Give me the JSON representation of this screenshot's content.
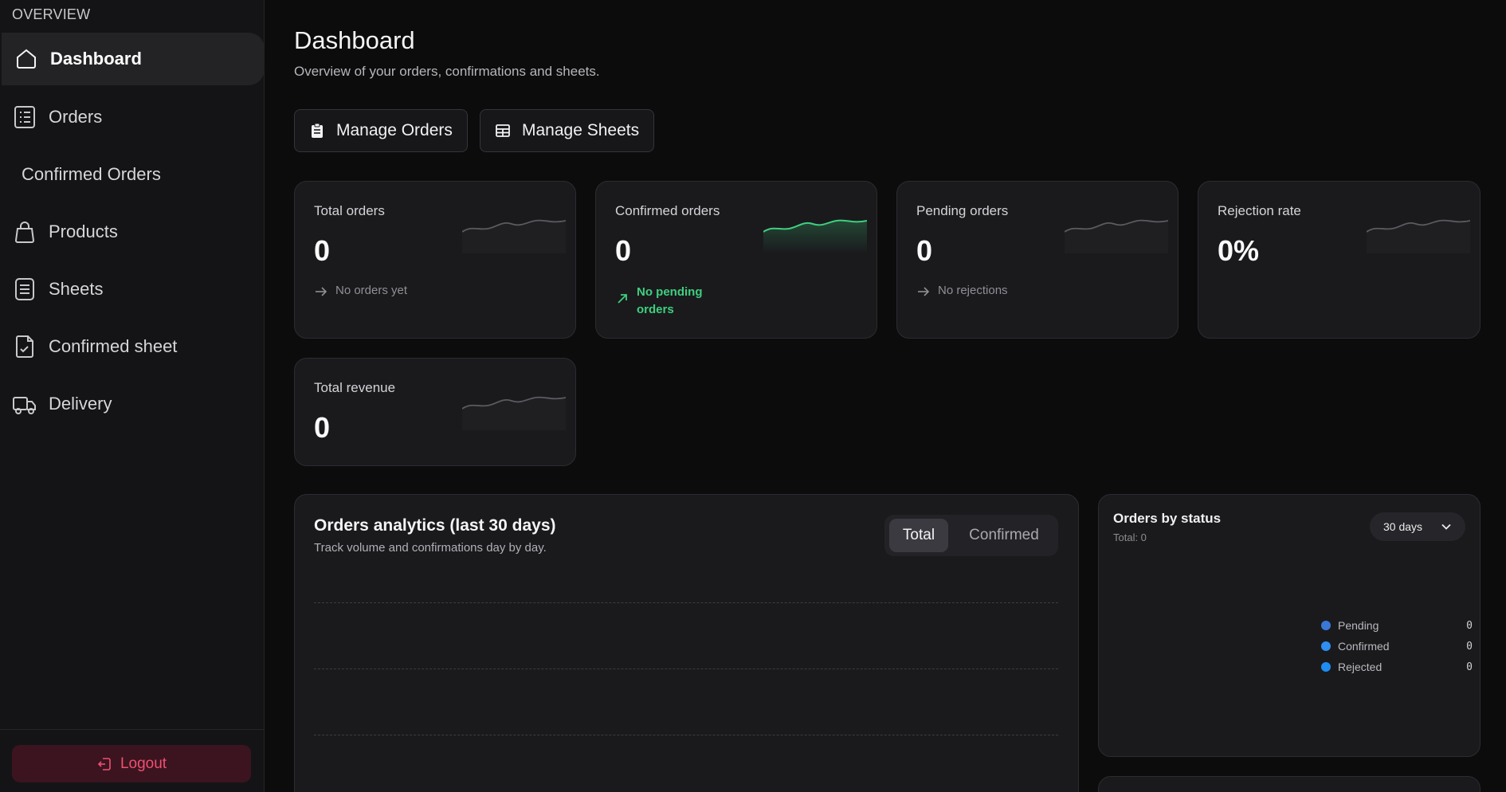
{
  "sidebar": {
    "section": "OVERVIEW",
    "items": [
      {
        "label": "Dashboard",
        "icon": "home-icon",
        "active": true
      },
      {
        "label": "Orders",
        "icon": "list-icon"
      },
      {
        "label": "Confirmed Orders",
        "icon": ""
      },
      {
        "label": "Products",
        "icon": "bag-icon"
      },
      {
        "label": "Sheets",
        "icon": "sheet-icon"
      },
      {
        "label": "Confirmed sheet",
        "icon": "file-check-icon"
      },
      {
        "label": "Delivery",
        "icon": "truck-icon"
      }
    ],
    "logout": "Logout"
  },
  "header": {
    "title": "Dashboard",
    "subtitle": "Overview of your orders, confirmations and sheets."
  },
  "actions": {
    "manage_orders": "Manage Orders",
    "manage_sheets": "Manage Sheets"
  },
  "stats": [
    {
      "label": "Total orders",
      "value": "0",
      "note": "No orders yet"
    },
    {
      "label": "Confirmed orders",
      "value": "0",
      "note": "No pending orders"
    },
    {
      "label": "Pending orders",
      "value": "0",
      "note": "No rejections"
    },
    {
      "label": "Rejection rate",
      "value": "0%"
    },
    {
      "label": "Total revenue",
      "value": "0"
    }
  ],
  "analytics": {
    "title": "Orders analytics (last 30 days)",
    "subtitle": "Track volume and confirmations day by day.",
    "tabs": [
      "Total",
      "Confirmed"
    ],
    "active_tab": "Total"
  },
  "status_panel": {
    "title": "Orders by status",
    "total": "Total: 0",
    "range": "30 days",
    "legend": [
      {
        "label": "Pending",
        "value": "0",
        "color": "#3a78d8"
      },
      {
        "label": "Confirmed",
        "value": "0",
        "color": "#2f8ef0"
      },
      {
        "label": "Rejected",
        "value": "0",
        "color": "#1f8cf2"
      }
    ]
  },
  "colors": {
    "accent_green": "#3ecf7e",
    "danger": "#f0506f"
  }
}
